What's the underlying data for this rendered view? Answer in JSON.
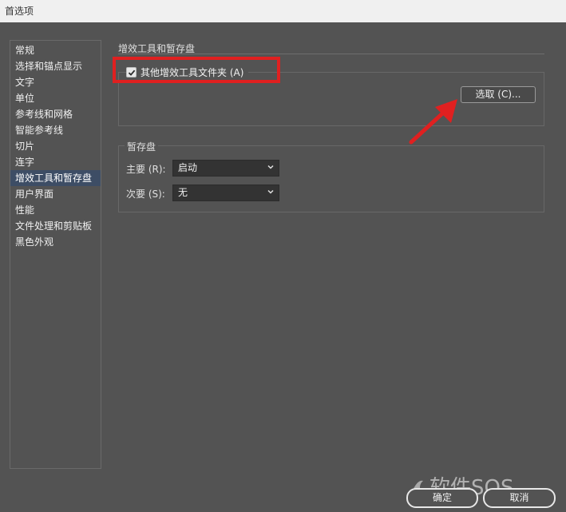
{
  "window": {
    "title": "首选项"
  },
  "sidebar": {
    "items": [
      {
        "label": "常规"
      },
      {
        "label": "选择和锚点显示"
      },
      {
        "label": "文字"
      },
      {
        "label": "单位"
      },
      {
        "label": "参考线和网格"
      },
      {
        "label": "智能参考线"
      },
      {
        "label": "切片"
      },
      {
        "label": "连字"
      },
      {
        "label": "增效工具和暂存盘",
        "selected": true
      },
      {
        "label": "用户界面"
      },
      {
        "label": "性能"
      },
      {
        "label": "文件处理和剪贴板"
      },
      {
        "label": "黑色外观"
      }
    ]
  },
  "main": {
    "section_title": "增效工具和暂存盘",
    "plugins": {
      "checkbox_label": "其他增效工具文件夹 (A)",
      "checked": true,
      "choose_button": "选取 (C)..."
    },
    "scratch": {
      "title": "暂存盘",
      "primary_label": "主要 (R):",
      "primary_value": "启动",
      "secondary_label": "次要 (S):",
      "secondary_value": "无"
    }
  },
  "footer": {
    "ok_label": "确定",
    "cancel_label": "取消"
  },
  "watermark": {
    "text": "软件SOS"
  },
  "colors": {
    "highlight": "#e02020",
    "selected_bg": "#3d4d65",
    "background": "#535353"
  }
}
